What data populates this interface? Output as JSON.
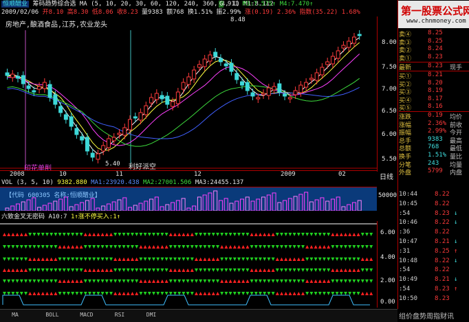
{
  "header": {
    "stock_name": "恒顺醋业",
    "formula": "筹码趋势综合选",
    "ma_params": "MA (5, 10, 20, 30, 60, 120, 240, 360, 4, 1)",
    "m1": "M1:8.112",
    "m3": "M3:7.575",
    "m4": "M4:7.470",
    "m_partial": "911",
    "date": "2009/02/06",
    "open": "开8.10",
    "high": "高8.30",
    "low": "低8.06",
    "close": "收8.23",
    "volume": "量9383",
    "amount": "额768",
    "turnover": "换1.51%",
    "amplitude": "振2.99%",
    "change": "涨(0.19)",
    "change_pct": "2.36%",
    "index": "指数(35.22)",
    "index_pct": "1.68%"
  },
  "sector_tags": "房地产,酿酒食品,江苏,农业龙头",
  "annotations": {
    "peak": "8.48",
    "trough": "5.40",
    "marker1": "印花单削",
    "marker2": "利好派空"
  },
  "x_axis": [
    "2008",
    "10",
    "11",
    "12",
    "2009",
    "02"
  ],
  "x_axis_right": "日线",
  "price_axis": [
    "8.00",
    "7.50",
    "7.00",
    "6.50",
    "6.00",
    "5.50"
  ],
  "price_top_partial": "8.25",
  "vol_header": {
    "label": "VOL (3, 5, 10)",
    "v": "9382.880",
    "ma1": "MA1:23920.438",
    "ma2": "MA2:27001.506",
    "ma3": "MA3:24455.137"
  },
  "vol_axis": "50000",
  "code_bar": "【代码 600305 名称:恒顺醋业】",
  "indicator": {
    "title": "六致金叉无密码",
    "param": "A10:7",
    "text1": "1↑涨不停买入:1↑",
    "axis": [
      "6.00",
      "4.00",
      "2.00",
      "0.00"
    ]
  },
  "quote": {
    "sells": [
      {
        "label": "卖④",
        "price": "8.25"
      },
      {
        "label": "卖③",
        "price": "8.25"
      },
      {
        "label": "卖②",
        "price": "8.24"
      },
      {
        "label": "卖①",
        "price": "8.23"
      }
    ],
    "latest": {
      "label": "最新",
      "price": "8.23",
      "extra": "现手"
    },
    "buys": [
      {
        "label": "买①",
        "price": "8.21"
      },
      {
        "label": "买②",
        "price": "8.20"
      },
      {
        "label": "买③",
        "price": "8.19"
      },
      {
        "label": "买④",
        "price": "8.17"
      },
      {
        "label": "买⑤",
        "price": "8.16"
      }
    ],
    "stats": [
      {
        "label": "涨跌",
        "value": "0.19",
        "extra": "均价"
      },
      {
        "label": "涨幅",
        "value": "2.36%",
        "extra": "前收"
      },
      {
        "label": "振幅",
        "value": "2.99%",
        "extra": "今开"
      },
      {
        "label": "总手",
        "value": "9383",
        "extra": "最高"
      },
      {
        "label": "总额",
        "value": "768",
        "extra": "最低"
      },
      {
        "label": "换手",
        "value": "1.51%",
        "extra": "量比"
      },
      {
        "label": "分笔",
        "value": "243",
        "extra": "均量"
      }
    ],
    "outer": {
      "label": "外盘",
      "value": "5799",
      "extra": "内盘"
    }
  },
  "ticks": [
    {
      "time": "10:44",
      "price": "8.22",
      "dir": ""
    },
    {
      "time": "10:45",
      "price": "8.22",
      "dir": ""
    },
    {
      "time": ":54",
      "price": "8.23",
      "dir": "↓"
    },
    {
      "time": "10:46",
      "price": "8.22",
      "dir": "↓"
    },
    {
      "time": ":36",
      "price": "8.22",
      "dir": ""
    },
    {
      "time": "10:47",
      "price": "8.21",
      "dir": "↓"
    },
    {
      "time": ":31",
      "price": "8.25",
      "dir": "↑"
    },
    {
      "time": "10:48",
      "price": "8.22",
      "dir": "↓"
    },
    {
      "time": ":54",
      "price": "8.22",
      "dir": ""
    },
    {
      "time": "10:49",
      "price": "8.21",
      "dir": "↓"
    },
    {
      "time": ":54",
      "price": "8.23",
      "dir": "↑"
    },
    {
      "time": "10:50",
      "price": "8.23",
      "dir": ""
    }
  ],
  "bottom_tabs": [
    "MA",
    "BOLL",
    "MACD",
    "RSI",
    "DMI"
  ],
  "bottom_right": "组价盘势周指财讯",
  "watermark": {
    "title": "第一股票公式网",
    "url": "www.chnmoney.com"
  },
  "colors": {
    "up": "#ff3b3b",
    "down": "#3ddc3d",
    "accent": "#40e0e0",
    "bg": "#000000"
  }
}
